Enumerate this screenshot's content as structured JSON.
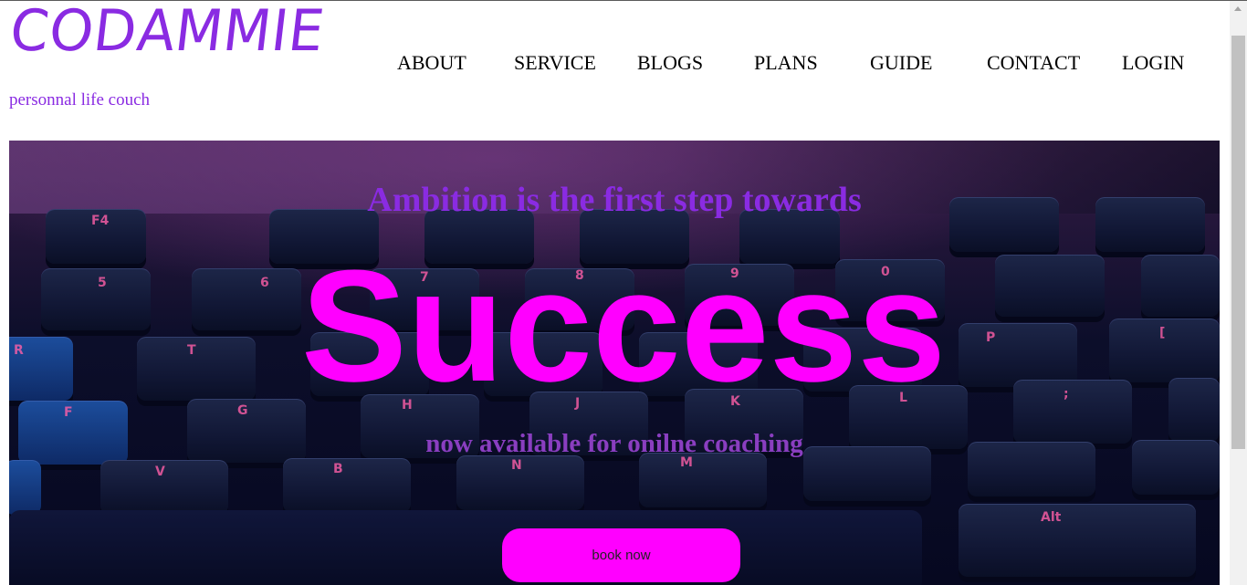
{
  "brand": {
    "logo": "CODAMMIE",
    "tagline": "personnal life couch",
    "color": "#8a2be2"
  },
  "nav": {
    "items": [
      {
        "label": "ABOUT"
      },
      {
        "label": "SERVICE"
      },
      {
        "label": "BLOGS"
      },
      {
        "label": "PLANS"
      },
      {
        "label": "GUIDE"
      },
      {
        "label": "CONTACT"
      },
      {
        "label": "LOGIN"
      }
    ]
  },
  "hero": {
    "headline": "Ambition is the first step towards",
    "big_word": "Success",
    "subline": "now available for onilne coaching",
    "button_label": "book now",
    "accent_color": "#ff00ff",
    "background": "keyboard-photo"
  },
  "scrollbar": {
    "icon": "scroll-up-arrow-icon"
  }
}
